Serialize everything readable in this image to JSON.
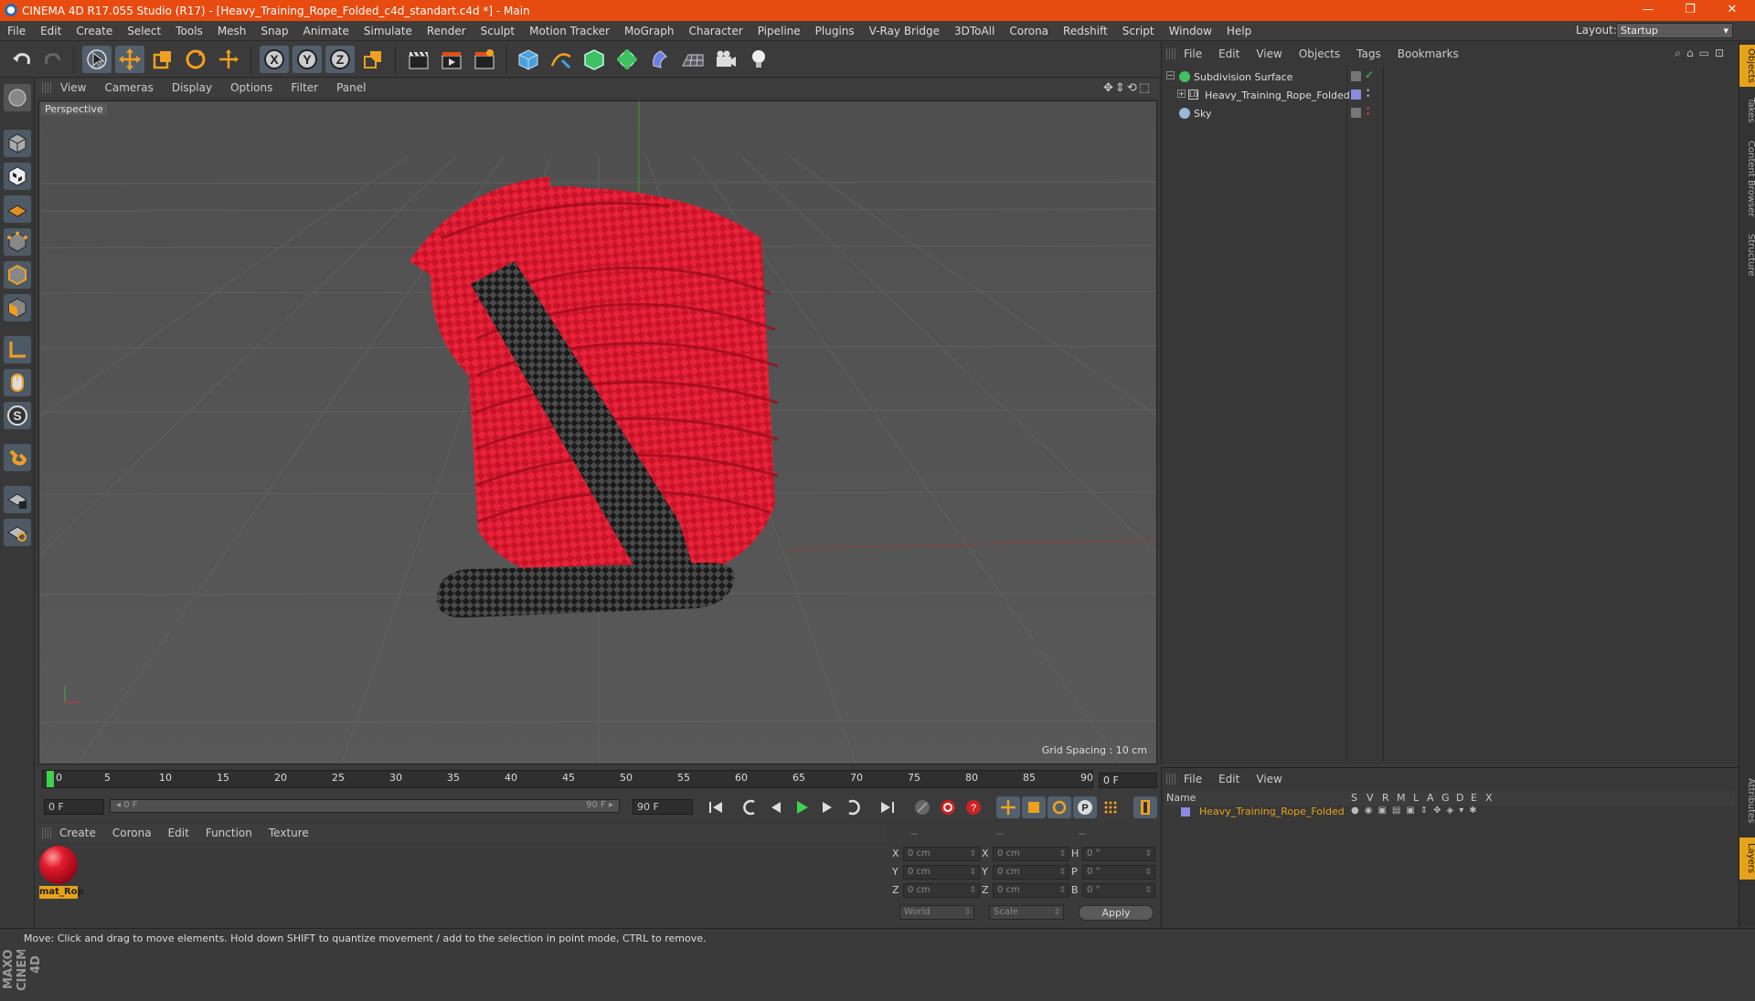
{
  "window": {
    "title": "CINEMA 4D R17.055 Studio (R17) - [Heavy_Training_Rope_Folded_c4d_standart.c4d *] - Main",
    "controls": [
      "—",
      "❐",
      "✕"
    ]
  },
  "menubar": {
    "items": [
      "File",
      "Edit",
      "Create",
      "Select",
      "Tools",
      "Mesh",
      "Snap",
      "Animate",
      "Simulate",
      "Render",
      "Sculpt",
      "Motion Tracker",
      "MoGraph",
      "Character",
      "Pipeline",
      "Plugins",
      "V-Ray Bridge",
      "3DToAll",
      "Corona",
      "Redshift",
      "Script",
      "Window",
      "Help"
    ],
    "layout_label": "Layout:",
    "layout_value": "Startup"
  },
  "viewport": {
    "menu": [
      "View",
      "Cameras",
      "Display",
      "Options",
      "Filter",
      "Panel"
    ],
    "label": "Perspective",
    "grid_spacing": "Grid Spacing : 10 cm",
    "nav_icons": "✥⇕⟲⬚"
  },
  "timeline": {
    "ticks": [
      "0",
      "5",
      "10",
      "15",
      "20",
      "25",
      "30",
      "35",
      "40",
      "45",
      "50",
      "55",
      "60",
      "65",
      "70",
      "75",
      "80",
      "85",
      "90"
    ],
    "current_frame": "0 F",
    "start_field": "0 F",
    "range_start": "◂ 0 F",
    "range_end": "90 F ▸",
    "end_field": "90 F"
  },
  "material_manager": {
    "menu": [
      "Create",
      "Corona",
      "Edit",
      "Function",
      "Texture"
    ],
    "material_name": "mat_Rop",
    "material_color": "#e21a2c"
  },
  "coordinates": {
    "headers": [
      "--",
      "--",
      "--"
    ],
    "rows": [
      {
        "axis": "X",
        "pos": "0 cm",
        "axis2": "X",
        "size": "0 cm",
        "rot_label": "H",
        "rot": "0 °"
      },
      {
        "axis": "Y",
        "pos": "0 cm",
        "axis2": "Y",
        "size": "0 cm",
        "rot_label": "P",
        "rot": "0 °"
      },
      {
        "axis": "Z",
        "pos": "0 cm",
        "axis2": "Z",
        "size": "0 cm",
        "rot_label": "B",
        "rot": "0 °"
      }
    ],
    "mode": "World",
    "transform": "Scale",
    "apply": "Apply"
  },
  "object_manager": {
    "menu": [
      "File",
      "Edit",
      "View",
      "Objects",
      "Tags",
      "Bookmarks"
    ],
    "objects": [
      {
        "name": "Subdivision Surface",
        "level": 0
      },
      {
        "name": "Heavy_Training_Rope_Folded",
        "level": 1
      },
      {
        "name": "Sky",
        "level": 0
      }
    ]
  },
  "layer_manager": {
    "menu": [
      "File",
      "Edit",
      "View"
    ],
    "header_name": "Name",
    "header_cols": [
      "S",
      "V",
      "R",
      "M",
      "L",
      "A",
      "G",
      "D",
      "E",
      "X"
    ],
    "layer_name": "Heavy_Training_Rope_Folded",
    "layer_color": "#e6a21a"
  },
  "right_tabs": [
    "Objects",
    "Takes",
    "Content Browser",
    "Structure",
    "Attributes",
    "Layers"
  ],
  "branding": "MAXON CINEMA 4D",
  "status": "Move: Click and drag to move elements. Hold down SHIFT to quantize movement / add to the selection in point mode, CTRL to remove.",
  "colors": {
    "accent": "#e84b10",
    "selection": "#e6a21a",
    "rope_red": "#e21a2c",
    "rope_black": "#2a2a2a"
  }
}
